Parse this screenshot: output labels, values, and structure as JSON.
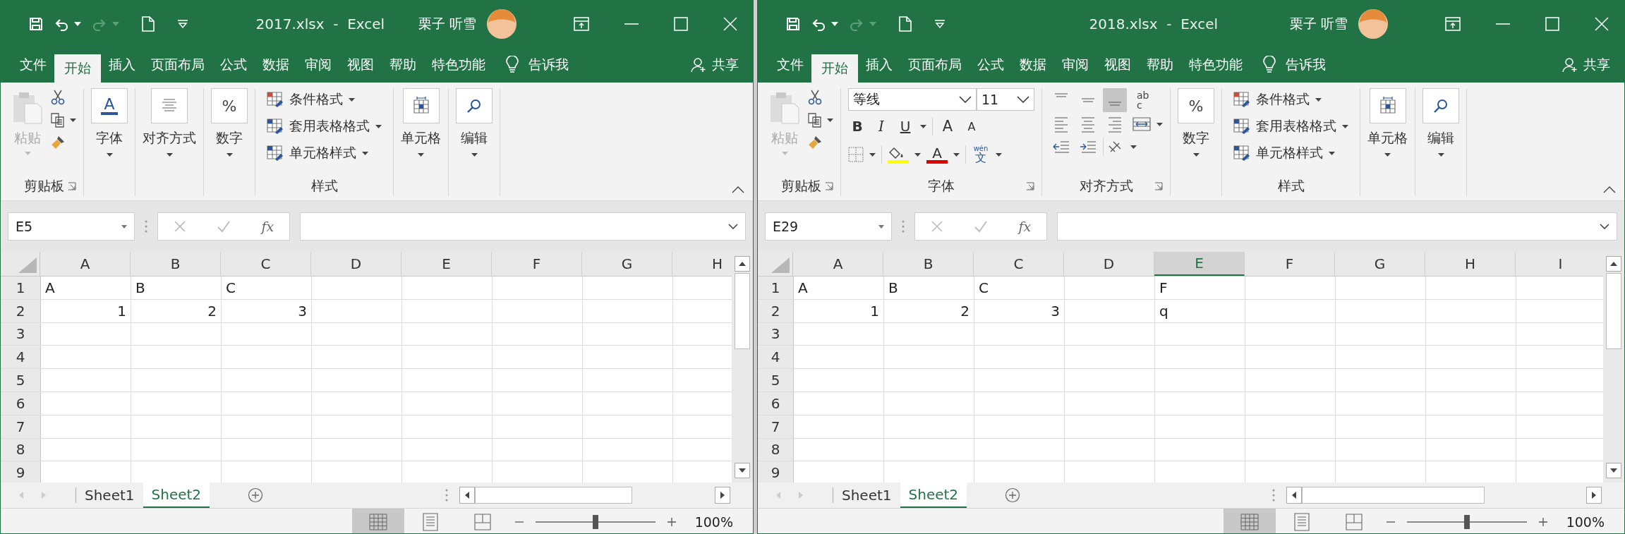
{
  "windows": [
    {
      "title": "2017.xlsx  -  Excel",
      "user": "栗子 听雪",
      "tabs": [
        {
          "label": "文件",
          "selected": false
        },
        {
          "label": "开始",
          "selected": true
        },
        {
          "label": "插入",
          "selected": false
        },
        {
          "label": "页面布局",
          "selected": false
        },
        {
          "label": "公式",
          "selected": false
        },
        {
          "label": "数据",
          "selected": false
        },
        {
          "label": "审阅",
          "selected": false
        },
        {
          "label": "视图",
          "selected": false
        },
        {
          "label": "帮助",
          "selected": false
        },
        {
          "label": "特色功能",
          "selected": false
        }
      ],
      "tell_me": "告诉我",
      "share": "共享",
      "ribbon": [
        {
          "kind": "clipboard",
          "paste": "粘贴",
          "label": "剪贴板"
        },
        {
          "kind": "font_button",
          "glyph": "A",
          "button": "字体"
        },
        {
          "kind": "alignment_button",
          "button": "对齐方式"
        },
        {
          "kind": "number",
          "glyph": "%",
          "button": "数字"
        },
        {
          "kind": "styles",
          "items": [
            "条件格式",
            "套用表格格式",
            "单元格样式"
          ],
          "label": "样式"
        },
        {
          "kind": "cells",
          "button": "单元格"
        },
        {
          "kind": "editing",
          "button": "编辑"
        }
      ],
      "name_box": "E5",
      "fx": "fx",
      "columns": [
        {
          "label": "A",
          "selected": false
        },
        {
          "label": "B",
          "selected": false
        },
        {
          "label": "C",
          "selected": false
        },
        {
          "label": "D",
          "selected": false
        },
        {
          "label": "E",
          "selected": false
        },
        {
          "label": "F",
          "selected": false
        },
        {
          "label": "G",
          "selected": false
        },
        {
          "label": "H",
          "selected": false
        }
      ],
      "rows": [
        {
          "label": "1",
          "cells": [
            {
              "kind": "text",
              "text": "A"
            },
            {
              "kind": "text",
              "text": "B"
            },
            {
              "kind": "text",
              "text": "C"
            }
          ]
        },
        {
          "label": "2",
          "cells": [
            {
              "kind": "number",
              "text": "1"
            },
            {
              "kind": "number",
              "text": "2"
            },
            {
              "kind": "number",
              "text": "3"
            }
          ]
        },
        {
          "label": "3"
        },
        {
          "label": "4"
        },
        {
          "label": "5"
        },
        {
          "label": "6"
        },
        {
          "label": "7"
        },
        {
          "label": "8"
        },
        {
          "label": "9"
        }
      ],
      "sheets": [
        {
          "label": "Sheet1",
          "selected": false
        },
        {
          "label": "Sheet2",
          "selected": true
        }
      ],
      "zoom": "100%",
      "zoom_slider": {
        "level": 0.5
      }
    },
    {
      "title": "2018.xlsx  -  Excel",
      "user": "栗子 听雪",
      "tabs": [
        {
          "label": "文件",
          "selected": false
        },
        {
          "label": "开始",
          "selected": true
        },
        {
          "label": "插入",
          "selected": false
        },
        {
          "label": "页面布局",
          "selected": false
        },
        {
          "label": "公式",
          "selected": false
        },
        {
          "label": "数据",
          "selected": false
        },
        {
          "label": "审阅",
          "selected": false
        },
        {
          "label": "视图",
          "selected": false
        },
        {
          "label": "帮助",
          "selected": false
        },
        {
          "label": "特色功能",
          "selected": false
        }
      ],
      "tell_me": "告诉我",
      "share": "共享",
      "ribbon": [
        {
          "kind": "clipboard",
          "paste": "粘贴",
          "label": "剪贴板"
        },
        {
          "kind": "font",
          "font": "等线",
          "size": "11",
          "bold": "B",
          "italic": "I",
          "underline": "U",
          "grow": "A",
          "shrink": "A",
          "font_color": "A",
          "phonetic_top": "wén",
          "phonetic": "文",
          "label": "字体"
        },
        {
          "kind": "alignment",
          "vertical": [
            {
              "selected": false
            },
            {
              "selected": false
            },
            {
              "selected": true
            }
          ],
          "wrap_top": "ab",
          "wrap_bottom": "c",
          "label": "对齐方式"
        },
        {
          "kind": "number",
          "glyph": "%",
          "button": "数字"
        },
        {
          "kind": "styles",
          "items": [
            "条件格式",
            "套用表格格式",
            "单元格样式"
          ],
          "label": "样式"
        },
        {
          "kind": "cells",
          "button": "单元格"
        },
        {
          "kind": "editing",
          "button": "编辑"
        }
      ],
      "name_box": "E29",
      "fx": "fx",
      "columns": [
        {
          "label": "A",
          "selected": false
        },
        {
          "label": "B",
          "selected": false
        },
        {
          "label": "C",
          "selected": false
        },
        {
          "label": "D",
          "selected": false
        },
        {
          "label": "E",
          "selected": true
        },
        {
          "label": "F",
          "selected": false
        },
        {
          "label": "G",
          "selected": false
        },
        {
          "label": "H",
          "selected": false
        },
        {
          "label": "I",
          "selected": false
        }
      ],
      "rows": [
        {
          "label": "1",
          "cells": [
            {
              "kind": "text",
              "text": "A"
            },
            {
              "kind": "text",
              "text": "B"
            },
            {
              "kind": "text",
              "text": "C"
            },
            null,
            {
              "kind": "text",
              "text": "F"
            }
          ]
        },
        {
          "label": "2",
          "cells": [
            {
              "kind": "number",
              "text": "1"
            },
            {
              "kind": "number",
              "text": "2"
            },
            {
              "kind": "number",
              "text": "3"
            },
            null,
            {
              "kind": "text",
              "text": "q"
            }
          ]
        },
        {
          "label": "3"
        },
        {
          "label": "4"
        },
        {
          "label": "5"
        },
        {
          "label": "6"
        },
        {
          "label": "7"
        },
        {
          "label": "8"
        },
        {
          "label": "9"
        }
      ],
      "sheets": [
        {
          "label": "Sheet1",
          "selected": false
        },
        {
          "label": "Sheet2",
          "selected": true
        }
      ],
      "zoom": "100%",
      "zoom_slider": {
        "level": 0.5
      }
    }
  ]
}
